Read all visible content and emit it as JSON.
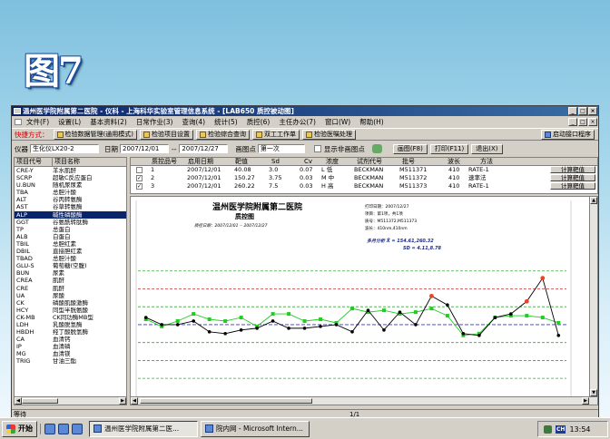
{
  "slide": {
    "title": "图7"
  },
  "window": {
    "title": "温州医学院附属第二医院 - 仪科 - 上海科华实验室管理信息系统 - [LAB650 质控被动图]",
    "menu": [
      "文件(F)",
      "设置(L)",
      "基本资料(2)",
      "日常作业(3)",
      "查询(4)",
      "统计(5)",
      "质控(6)",
      "主任办公(7)",
      "窗口(W)",
      "帮助(H)"
    ],
    "toolbar": {
      "quick_label": "快捷方式：",
      "buttons": [
        "检验数据管理(通用模式)",
        "检验项目设置",
        "检验综合查询",
        "双工工作单",
        "检验医嘱处理"
      ],
      "right_button": "启动接口程序"
    },
    "options": {
      "instrument_label": "仪器",
      "instrument_value": "生化仪LX20-2",
      "date_label": "日期",
      "date_from": "2007/12/01",
      "date_sep": "--",
      "date_to": "2007/12/27",
      "point_label": "画图点",
      "point_value": "第一次",
      "show_nonplot_label": "显示非画图点",
      "btn_plot": "画图(F8)",
      "btn_print": "打印(F11)",
      "btn_exit": "退出(X)"
    },
    "items_panel": {
      "headers": [
        "项目代号",
        "项目名称"
      ],
      "rows": [
        [
          "CRE-Y",
          "羊水肌酐"
        ],
        [
          "SCRP",
          "超敏C反应蛋白"
        ],
        [
          "U.BUN",
          "随机尿尿素"
        ],
        [
          "TBA",
          "总胆汁酸"
        ],
        [
          "ALT",
          "谷丙转氨酶"
        ],
        [
          "AST",
          "谷草转氨酶"
        ],
        [
          "ALP",
          "碱性磷酸酶"
        ],
        [
          "GGT",
          "谷氨酰转肽酶"
        ],
        [
          "TP",
          "总蛋白"
        ],
        [
          "ALB",
          "白蛋白"
        ],
        [
          "TBIL",
          "总胆红素"
        ],
        [
          "DBIL",
          "直接胆红素"
        ],
        [
          "TBAD",
          "总胆汁酸"
        ],
        [
          "GLU-S",
          "葡萄糖(空腹)"
        ],
        [
          "BUN",
          "尿素"
        ],
        [
          "CREA",
          "肌酐"
        ],
        [
          "CRE",
          "肌酐"
        ],
        [
          "UA",
          "尿酸"
        ],
        [
          "CK",
          "磷酸肌酸激酶"
        ],
        [
          "HCY",
          "同型半胱氨酸"
        ],
        [
          "CK-MB",
          "CK同功酶MB型"
        ],
        [
          "LDH",
          "乳酸脱氢酶"
        ],
        [
          "HBDH",
          "羟丁酸脱氢酶"
        ],
        [
          "CA",
          "血清钙"
        ],
        [
          "IP",
          "血清磷"
        ],
        [
          "MG",
          "血清镁"
        ],
        [
          "TRIG",
          "甘油三酯"
        ]
      ],
      "selected_code": "ALP"
    },
    "grid": {
      "headers": [
        "质控品号",
        "启用日期",
        "靶值",
        "Sd",
        "Cv",
        "浓度",
        "试剂代号",
        "批号",
        "波长",
        "方法"
      ],
      "rows": [
        {
          "checked": false,
          "no": "1",
          "date": "2007/12/01",
          "target": "40.08",
          "sd": "3.0",
          "cv": "0.07",
          "level": "L 低",
          "reagent": "BECKMAN",
          "lot": "M511371",
          "wave": "410",
          "method": "RATE-1",
          "calc": "计算靶值"
        },
        {
          "checked": true,
          "no": "2",
          "date": "2007/12/01",
          "target": "150.27",
          "sd": "3.75",
          "cv": "0.03",
          "level": "M 中",
          "reagent": "BECKMAN",
          "lot": "M511372",
          "wave": "410",
          "method": "速率法",
          "calc": "计算靶值"
        },
        {
          "checked": true,
          "no": "3",
          "date": "2007/12/01",
          "target": "260.22",
          "sd": "7.5",
          "cv": "0.03",
          "level": "H 高",
          "reagent": "BECKMAN",
          "lot": "M511373",
          "wave": "410",
          "method": "RATE-1",
          "calc": "计算靶值"
        }
      ]
    },
    "chart_panel": {
      "hospital": "温州医学院附属第二医院",
      "subtitle": "质控图",
      "date_line": "质控日期：2007/12/01 -- 2007/12/27",
      "info": [
        "打印日期：2007/12/27",
        "项目：第1项，共1项",
        "质号：M511372,M511373",
        "波长：410nm,410nm"
      ],
      "stats_line": "多月分析 X̄ = 154.61,260.32",
      "sd_line": "SD = 4.11,8.78"
    },
    "chart_data": {
      "type": "line",
      "series": [
        {
          "color": "#22cc22",
          "values": [
            0.3,
            -0.1,
            0.2,
            0.6,
            0.3,
            0.2,
            0.4,
            -0.1,
            0.6,
            0.6,
            0.2,
            0.3,
            0.1,
            0.9,
            0.7,
            0.8,
            0.6,
            0.7,
            0.9,
            0.5,
            -0.6,
            -0.5,
            0.4,
            0.5,
            0.5,
            0.4,
            0.1
          ]
        },
        {
          "color": "#000000",
          "values": [
            0.4,
            0.0,
            0.0,
            0.2,
            -0.4,
            -0.5,
            -0.3,
            -0.2,
            0.2,
            -0.2,
            -0.2,
            -0.1,
            0.0,
            -0.4,
            0.8,
            -0.3,
            0.7,
            0.0,
            1.6,
            1.1,
            -0.5,
            -0.6,
            0.4,
            0.6,
            1.3,
            2.6,
            -0.6
          ]
        }
      ],
      "ylim": [
        -3.5,
        4
      ],
      "limit_lines": [
        {
          "y": 0,
          "color": "#3333cc"
        },
        {
          "y": 1,
          "color": "#33aa33"
        },
        {
          "y": -1,
          "color": "#33aa33"
        },
        {
          "y": 2,
          "color": "#cc3333"
        },
        {
          "y": -2,
          "color": "#cc3333"
        },
        {
          "y": 3,
          "color": "#33aa33"
        },
        {
          "y": -3,
          "color": "#33aa33"
        }
      ],
      "highlight_points": [
        18,
        24,
        25
      ]
    },
    "status": {
      "left": "等待",
      "center": "1/1"
    }
  },
  "taskbar": {
    "start": "开始",
    "tasks": [
      "温州医学院附属第二医...",
      "院内网 - Microsoft Intern..."
    ],
    "tray_lang": "CH",
    "clock": "13:54"
  }
}
